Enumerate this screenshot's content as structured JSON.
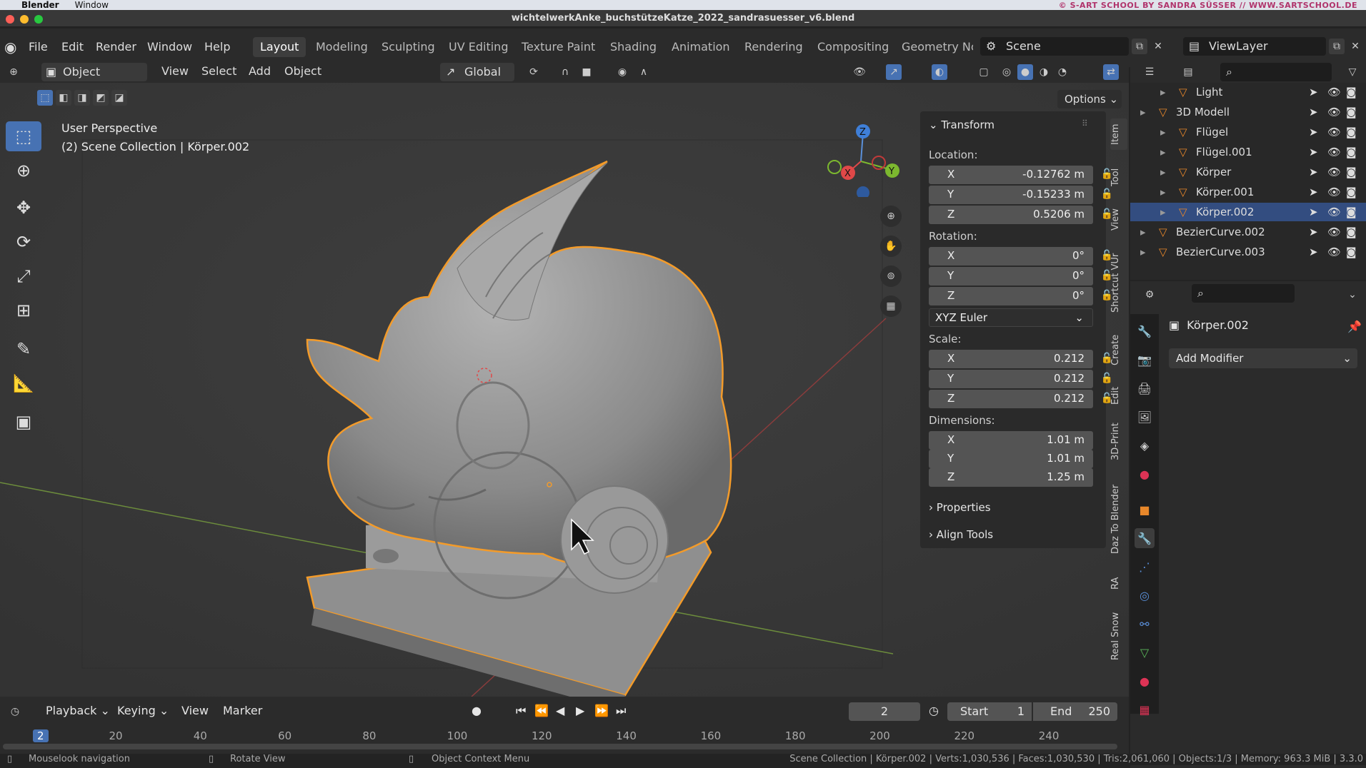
{
  "mac_menu": {
    "app": "Blender",
    "window": "Window",
    "credit": "© S-ART SCHOOL BY SANDRA SÜSSER // WWW.SARTSCHOOL.DE"
  },
  "window_title": "wichtelwerkAnke_buchstützeKatze_2022_sandrasuesser_v6.blend",
  "menus": [
    "File",
    "Edit",
    "Render",
    "Window",
    "Help"
  ],
  "workspaces": [
    "Layout",
    "Modeling",
    "Sculpting",
    "UV Editing",
    "Texture Paint",
    "Shading",
    "Animation",
    "Rendering",
    "Compositing",
    "Geometry Nc"
  ],
  "scene": "Scene",
  "view_layer": "ViewLayer",
  "header": {
    "mode": "Object Mode",
    "view": "View",
    "select": "Select",
    "add": "Add",
    "object": "Object",
    "transform_orientation": "Global",
    "options": "Options"
  },
  "viewport": {
    "perspective": "User Perspective",
    "collection": "(2) Scene Collection | Körper.002"
  },
  "gizmo": {
    "x": "X",
    "y": "Y",
    "z": "Z"
  },
  "npanel": {
    "transform": "Transform",
    "location_label": "Location:",
    "location": [
      {
        "axis": "X",
        "value": "-0.12762 m"
      },
      {
        "axis": "Y",
        "value": "-0.15233 m"
      },
      {
        "axis": "Z",
        "value": "0.5206 m"
      }
    ],
    "rotation_label": "Rotation:",
    "rotation": [
      {
        "axis": "X",
        "value": "0°"
      },
      {
        "axis": "Y",
        "value": "0°"
      },
      {
        "axis": "Z",
        "value": "0°"
      }
    ],
    "rotation_mode": "XYZ Euler",
    "scale_label": "Scale:",
    "scale": [
      {
        "axis": "X",
        "value": "0.212"
      },
      {
        "axis": "Y",
        "value": "0.212"
      },
      {
        "axis": "Z",
        "value": "0.212"
      }
    ],
    "dimensions_label": "Dimensions:",
    "dimensions": [
      {
        "axis": "X",
        "value": "1.01 m"
      },
      {
        "axis": "Y",
        "value": "1.01 m"
      },
      {
        "axis": "Z",
        "value": "1.25 m"
      }
    ],
    "properties": "Properties",
    "align_tools": "Align Tools"
  },
  "vtabs": [
    "Item",
    "Tool",
    "View",
    "Shortcut VUr",
    "Create",
    "Edit",
    "3D-Print",
    "Daz To Blender",
    "RA",
    "Real Snow"
  ],
  "outliner": {
    "rows": [
      {
        "name": "Light",
        "indent": 1,
        "selected": false
      },
      {
        "name": "3D Modell",
        "indent": 0,
        "selected": false
      },
      {
        "name": "Flügel",
        "indent": 1,
        "selected": false
      },
      {
        "name": "Flügel.001",
        "indent": 1,
        "selected": false
      },
      {
        "name": "Körper",
        "indent": 1,
        "selected": false
      },
      {
        "name": "Körper.001",
        "indent": 1,
        "selected": false
      },
      {
        "name": "Körper.002",
        "indent": 1,
        "selected": true
      },
      {
        "name": "BezierCurve.002",
        "indent": 0,
        "selected": false
      },
      {
        "name": "BezierCurve.003",
        "indent": 0,
        "selected": false
      }
    ]
  },
  "properties": {
    "object_name": "Körper.002",
    "add_modifier": "Add Modifier"
  },
  "timeline": {
    "playback": "Playback",
    "keying": "Keying",
    "view": "View",
    "marker": "Marker",
    "current_frame": "2",
    "start_label": "Start",
    "start": "1",
    "end_label": "End",
    "end": "250",
    "ticks": [
      "2",
      "20",
      "40",
      "60",
      "80",
      "100",
      "120",
      "140",
      "160",
      "180",
      "200",
      "220",
      "240"
    ]
  },
  "status": {
    "left1": "Mouselook navigation",
    "left2": "Rotate View",
    "left3": "Object Context Menu",
    "right": "Scene Collection | Körper.002 | Verts:1,030,536 | Faces:1,030,530 | Tris:2,061,060 | Objects:1/3 | Memory: 963.3 MiB | 3.3.0"
  }
}
